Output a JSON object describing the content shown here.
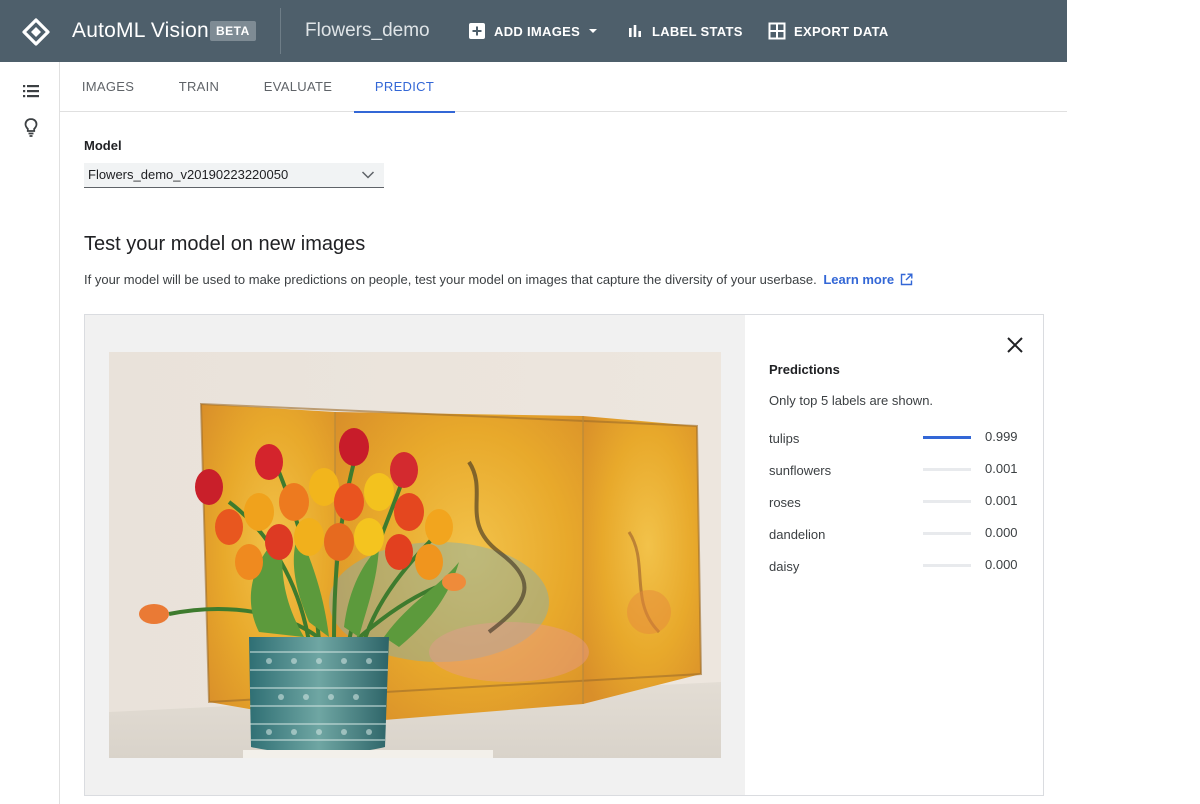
{
  "header": {
    "app_title": "AutoML Vision",
    "beta_badge": "BETA",
    "dataset_name": "Flowers_demo",
    "add_images_label": "ADD IMAGES",
    "label_stats_label": "LABEL STATS",
    "export_data_label": "EXPORT DATA",
    "background_color": "#4e5f6b"
  },
  "rail": {
    "icons": [
      "list-icon",
      "lightbulb-icon"
    ]
  },
  "tabs": [
    {
      "label": "IMAGES",
      "active": false
    },
    {
      "label": "TRAIN",
      "active": false
    },
    {
      "label": "EVALUATE",
      "active": false
    },
    {
      "label": "PREDICT",
      "active": true
    }
  ],
  "model": {
    "label": "Model",
    "selected": "Flowers_demo_v20190223220050"
  },
  "test": {
    "title": "Test your model on new images",
    "description": "If your model will be used to make predictions on people, test your model on images that capture the diversity of your userbase.",
    "learn_more": "Learn more"
  },
  "predictions": {
    "title": "Predictions",
    "note": "Only top 5 labels are shown.",
    "items": [
      {
        "label": "tulips",
        "value": "0.999",
        "score": 0.999
      },
      {
        "label": "sunflowers",
        "value": "0.001",
        "score": 0.001
      },
      {
        "label": "roses",
        "value": "0.001",
        "score": 0.001
      },
      {
        "label": "dandelion",
        "value": "0.000",
        "score": 0.0
      },
      {
        "label": "daisy",
        "value": "0.000",
        "score": 0.0
      }
    ]
  },
  "colors": {
    "accent": "#3367d6",
    "header": "#4e5f6b"
  }
}
